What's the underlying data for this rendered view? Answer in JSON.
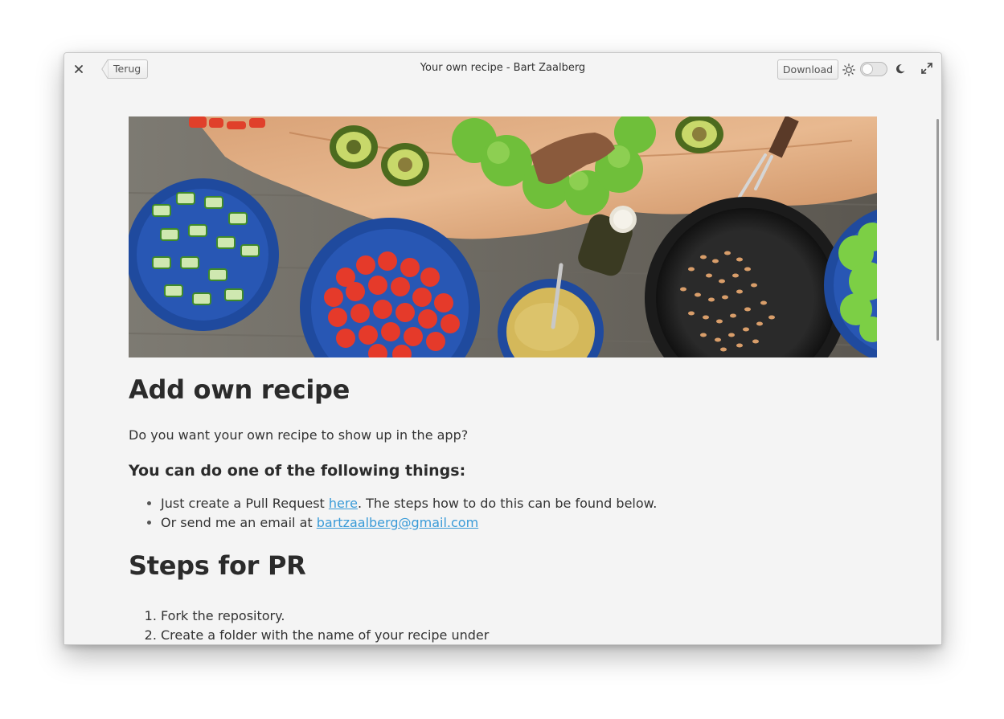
{
  "window": {
    "title": "Your own recipe - Bart Zaalberg",
    "back_label": "Terug",
    "download_label": "Download",
    "icons": [
      "close-icon",
      "sun-icon",
      "moon-icon",
      "maximize-icon"
    ],
    "theme_switch": {
      "state": "off"
    }
  },
  "colors": {
    "window_bg": "#f4f4f4",
    "text": "#333333",
    "heading": "#2b2b2b",
    "link": "#3a9bd8"
  },
  "article": {
    "heading": "Add own recipe",
    "intro": "Do you want your own recipe to show up in the app?",
    "subheading": "You can do one of the following things:",
    "options": [
      {
        "before": "Just create a Pull Request ",
        "link": "here",
        "after": ". The steps how to do this can be found below."
      },
      {
        "before": "Or send me an email at ",
        "link": "bartzaalberg@gmail.com",
        "after": ""
      }
    ],
    "steps_heading": "Steps for PR",
    "steps": [
      "Fork the repository.",
      "Create a folder with the name of your recipe under"
    ]
  }
}
